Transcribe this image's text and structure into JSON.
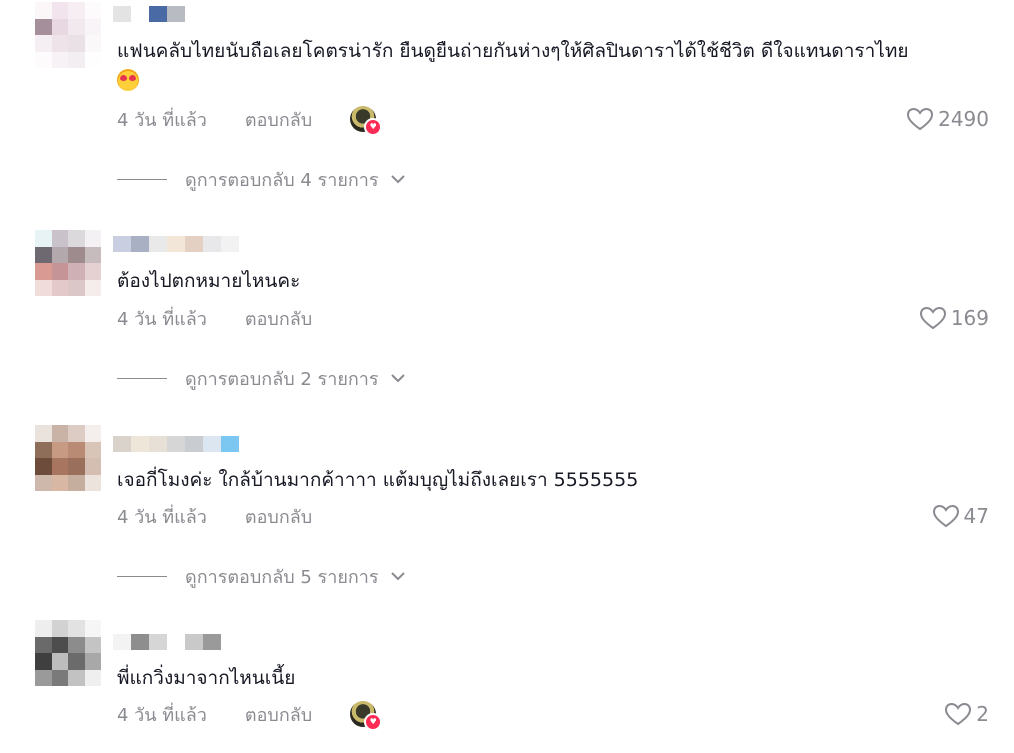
{
  "comments": [
    {
      "text": "แฟนคลับไทยนับถือเลยโคตรน่ารัก ยืนดูยืนถ่ายกันห่างๆให้ศิลปินดาราได้ใช้ชีวิต ดีใจแทนดาราไทย",
      "emoji": "smiling-face-with-heart-eyes",
      "time": "4 วัน ที่แล้ว",
      "reply_label": "ตอบกลับ",
      "creator_liked": true,
      "likes": "2490",
      "replies_label": "ดูการตอบกลับ 4 รายการ"
    },
    {
      "text": "ต้องไปตกหมายไหนคะ",
      "time": "4 วัน ที่แล้ว",
      "reply_label": "ตอบกลับ",
      "creator_liked": false,
      "likes": "169",
      "replies_label": "ดูการตอบกลับ 2 รายการ"
    },
    {
      "text": "เจอกี่โมงค่ะ ใกล้บ้านมากค้าาาา แต้มบุญไม่ถึงเลยเรา 5555555",
      "time": "4 วัน ที่แล้ว",
      "reply_label": "ตอบกลับ",
      "creator_liked": false,
      "likes": "47",
      "replies_label": "ดูการตอบกลับ 5 รายการ"
    },
    {
      "text": "พี่แกวิ่งมาจากไหนเนี้ย",
      "time": "4 วัน ที่แล้ว",
      "reply_label": "ตอบกลับ",
      "creator_liked": true,
      "likes": "2"
    }
  ],
  "colors": {
    "text": "#161823",
    "muted": "#8a8b91",
    "badge": "#fe2c55"
  },
  "icons": {
    "like": "heart-outline-icon",
    "expand": "chevron-down-icon",
    "creator_like_badge": "heart-badge-icon"
  }
}
